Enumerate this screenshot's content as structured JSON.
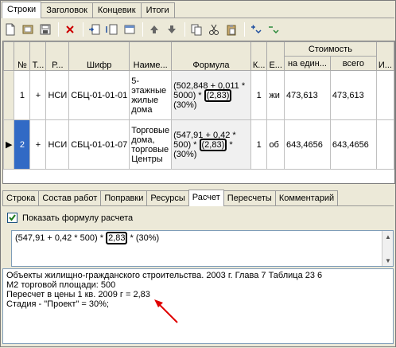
{
  "top_tabs": [
    "Строки",
    "Заголовок",
    "Концевик",
    "Итоги"
  ],
  "toolbar": {
    "icons": [
      "new-doc-icon",
      "open-book-icon",
      "save-icon",
      "delete-icon",
      "insert-row-icon",
      "indent-icon",
      "dock-icon",
      "arrow-up-icon",
      "arrow-down-icon",
      "copy-icon",
      "cut-icon",
      "paste-icon",
      "add-child-icon",
      "add-sibling-icon"
    ]
  },
  "grid": {
    "group_header": "Стоимость",
    "columns": [
      "№",
      "Т...",
      "Р...",
      "Шифр",
      "Наиме...",
      "Формула",
      "К...",
      "Е...",
      "на един...",
      "всего",
      "И..."
    ],
    "rows": [
      {
        "num": "1",
        "type": "+",
        "r": "НСИ",
        "code": "СБЦ-01-01-01",
        "name": "5-этажные жилые дома",
        "formula_pre": "(502,848 + 0,011 * 5000) * ",
        "formula_box": "(2,83)",
        "formula_post": " (30%)",
        "qty": "1",
        "unit": "жи",
        "unit_cost": "473,613",
        "total": "473,613"
      },
      {
        "num": "2",
        "type": "+",
        "r": "НСИ",
        "code": "СБЦ-01-01-07",
        "name": "Торговые дома, торговые Центры",
        "formula_pre": "(547,91 + 0,42 * 500) * ",
        "formula_box": "(2,83)",
        "formula_post": " * (30%)",
        "qty": "1",
        "unit": "об",
        "unit_cost": "643,4656",
        "total": "643,4656"
      }
    ]
  },
  "lower_tabs": [
    "Строка",
    "Состав работ",
    "Поправки",
    "Ресурсы",
    "Расчет",
    "Пересчеты",
    "Комментарий"
  ],
  "show_formula_label": "Показать формулу расчета",
  "formula": {
    "pre": "(547,91 + 0,42 * 500) * ",
    "boxed": "2,83",
    "post": " * (30%)"
  },
  "notes": [
    "Объекты жилищно-гражданского строительства. 2003 г.  Глава 7 Таблица 23 6",
    "М2 торговой площади: 500",
    "Пересчет в цены 1 кв. 2009 г = 2,83",
    "Стадия - \"Проект\" = 30%;"
  ]
}
